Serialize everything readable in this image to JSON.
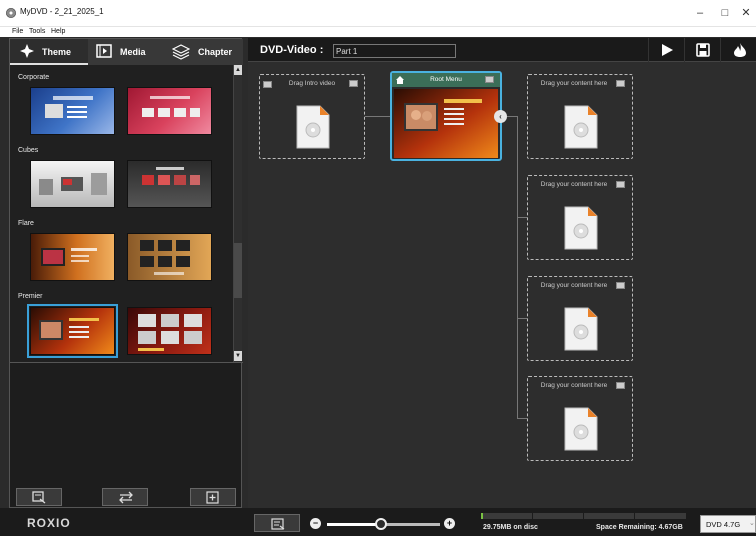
{
  "window": {
    "title": "MyDVD - 2_21_2025_1",
    "minimize": "–",
    "maximize": "□",
    "close": "✕"
  },
  "menu": [
    "File",
    "Tools",
    "Help"
  ],
  "tabs": [
    {
      "label": "Theme",
      "icon": "theme-icon",
      "active": true
    },
    {
      "label": "Media",
      "icon": "media-icon",
      "active": false
    },
    {
      "label": "Chapter",
      "icon": "chapter-icon",
      "active": false
    }
  ],
  "theme_groups": [
    {
      "name": "Corporate"
    },
    {
      "name": "Cubes"
    },
    {
      "name": "Flare"
    },
    {
      "name": "Premier"
    }
  ],
  "selected_theme": "Premier",
  "left_buttons": [
    "edit-menu-icon",
    "swap-icon",
    "add-icon"
  ],
  "project": {
    "type_label": "DVD-Video :",
    "title": "Part 1"
  },
  "toolbar": [
    "play-icon",
    "save-icon",
    "burn-icon"
  ],
  "intro_node": {
    "label": "Drag Intro video"
  },
  "root_menu": {
    "label": "Root Menu"
  },
  "content_nodes": [
    {
      "label": "Drag your content here"
    },
    {
      "label": "Drag your content here"
    },
    {
      "label": "Drag your content here"
    },
    {
      "label": "Drag your content here"
    }
  ],
  "collapse_glyph": "‹",
  "zoom": {
    "minus": "−",
    "plus": "+",
    "level": 0.48
  },
  "capacity": {
    "used_text": "29.75MB on disc",
    "remaining_text": "Space Remaining: 4.67GB",
    "used_fraction": 0.006
  },
  "disc_type": "DVD 4.7G",
  "brand": "ROXIO",
  "colors": {
    "accent": "#3aa0d8",
    "root_header": "#3b6e58",
    "capacity": "#7ac143"
  }
}
